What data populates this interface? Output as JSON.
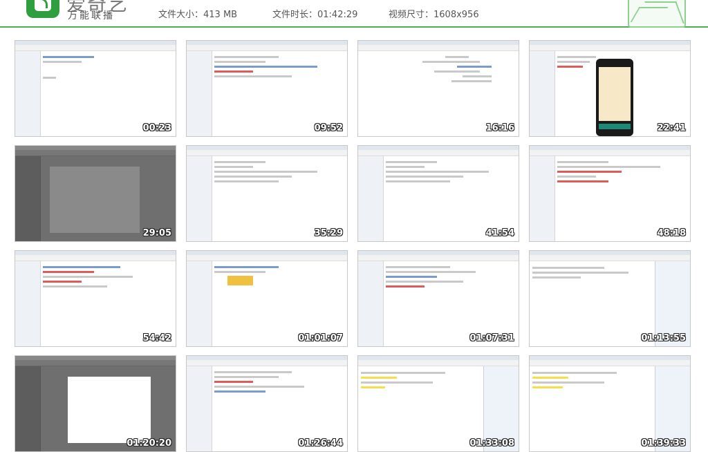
{
  "header": {
    "brand_main": "爱奇艺",
    "brand_sub": "万能联播",
    "file_size": "文件大小：413 MB",
    "duration": "文件时长：01:42:29",
    "video_size": "视频尺寸：1608x956"
  },
  "thumbnails": [
    {
      "time": "00:23"
    },
    {
      "time": "09:52"
    },
    {
      "time": "16:16"
    },
    {
      "time": "22:41"
    },
    {
      "time": "29:05"
    },
    {
      "time": "35:29"
    },
    {
      "time": "41:54"
    },
    {
      "time": "48:18"
    },
    {
      "time": "54:42"
    },
    {
      "time": "01:01:07"
    },
    {
      "time": "01:07:31"
    },
    {
      "time": "01:13:55"
    },
    {
      "time": "01:20:20"
    },
    {
      "time": "01:26:44"
    },
    {
      "time": "01:33:08"
    },
    {
      "time": "01:39:33"
    }
  ],
  "colors": {
    "accent": "#4caf50",
    "logo": "#2e9e3e"
  }
}
